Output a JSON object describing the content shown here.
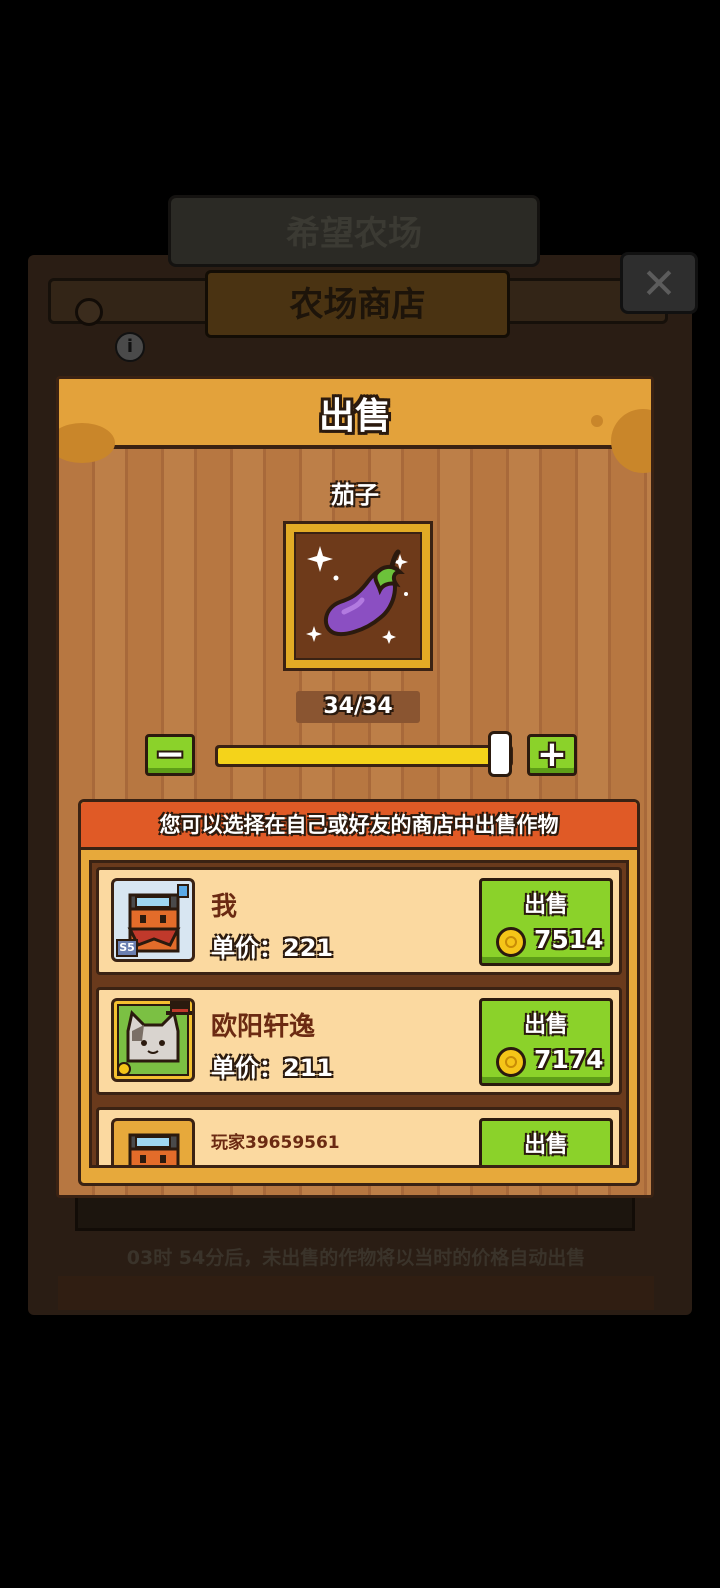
{
  "background": {
    "banner_top": "希望农场",
    "shop_title": "农场商店",
    "close_symbol": "✕",
    "info_symbol": "i",
    "auto_sell_notice": "03时 54分后，未出售的作物将以当时的价格自动出售"
  },
  "dialog": {
    "title": "出售",
    "item": {
      "name": "茄子",
      "icon": "eggplant-icon",
      "quantity_text": "34/34",
      "quantity_selected": 34,
      "quantity_max": 34
    },
    "controls": {
      "minus_label": "−",
      "plus_label": "+"
    },
    "list": {
      "header": "您可以选择在自己或好友的商店中出售作物",
      "rows": [
        {
          "name": "我",
          "level_badge": "S5",
          "price_text": "单价：221",
          "sell_label": "出售",
          "sell_amount": "7514"
        },
        {
          "name": "欧阳轩逸",
          "price_text": "单价：211",
          "sell_label": "出售",
          "sell_amount": "7174"
        },
        {
          "name": "玩家39659561",
          "sell_label": "出售"
        }
      ]
    }
  },
  "colors": {
    "header_orange": "#e3a23b",
    "wood": "#b77741",
    "button_green": "#8bd22a",
    "list_header_red": "#e05a26",
    "slider_yellow": "#f4d31a"
  }
}
